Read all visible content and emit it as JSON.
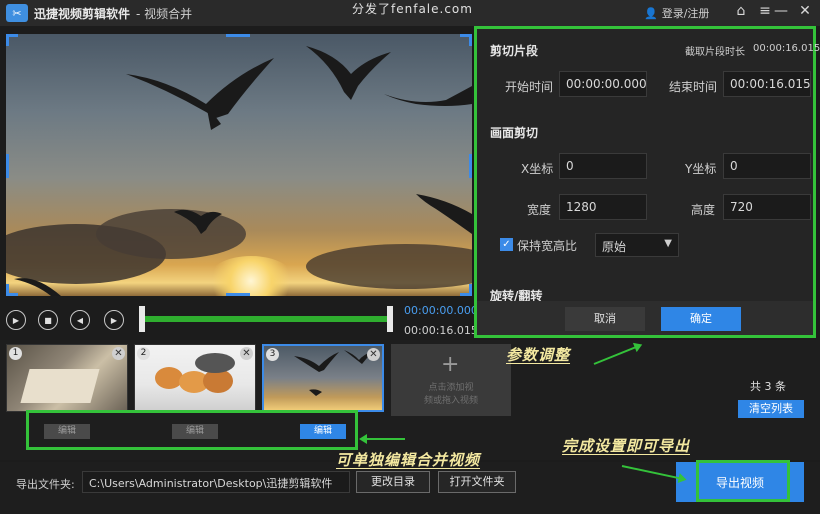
{
  "titlebar": {
    "app_name": "迅捷视频剪辑软件",
    "subtitle": "- 视频合并",
    "watermark": "分发了fenfale.com",
    "login": "登录/注册"
  },
  "player": {
    "current_time": "00:00:00.000",
    "total_time": "00:00:16.015"
  },
  "panel": {
    "cut_section": "剪切片段",
    "clip_duration_label": "截取片段时长",
    "clip_duration_value": "00:00:16.015",
    "start_label": "开始时间",
    "start_value": "00:00:00.000",
    "end_label": "结束时间",
    "end_value": "00:00:16.015",
    "crop_section": "画面剪切",
    "x_label": "X坐标",
    "x_value": "0",
    "y_label": "Y坐标",
    "y_value": "0",
    "width_label": "宽度",
    "width_value": "1280",
    "height_label": "高度",
    "height_value": "720",
    "keep_ratio_label": "保持宽高比",
    "ratio_option": "原始",
    "rotate_section": "旋转/翻转",
    "cancel": "取消",
    "ok": "确定"
  },
  "clips": [
    {
      "num": "1",
      "edit": "编辑"
    },
    {
      "num": "2",
      "edit": "编辑"
    },
    {
      "num": "3",
      "edit": "编辑"
    }
  ],
  "add_tile": {
    "line1": "点击添加视",
    "line2": "频或拖入视频"
  },
  "list": {
    "count": "共 3 条",
    "clear": "清空列表"
  },
  "bottom": {
    "output_label": "导出文件夹:",
    "output_path": "C:\\Users\\Administrator\\Desktop\\迅捷剪辑软件",
    "change_dir": "更改目录",
    "open_folder": "打开文件夹",
    "export": "导出视频"
  },
  "annotations": {
    "params": "参数调整",
    "edit_single": "可单独编辑合并视频",
    "export_hint": "完成设置即可导出"
  },
  "colors": {
    "accent_blue": "#2f86e6",
    "annotation_green": "#34c23a",
    "timeline_green": "#2fae2f"
  }
}
